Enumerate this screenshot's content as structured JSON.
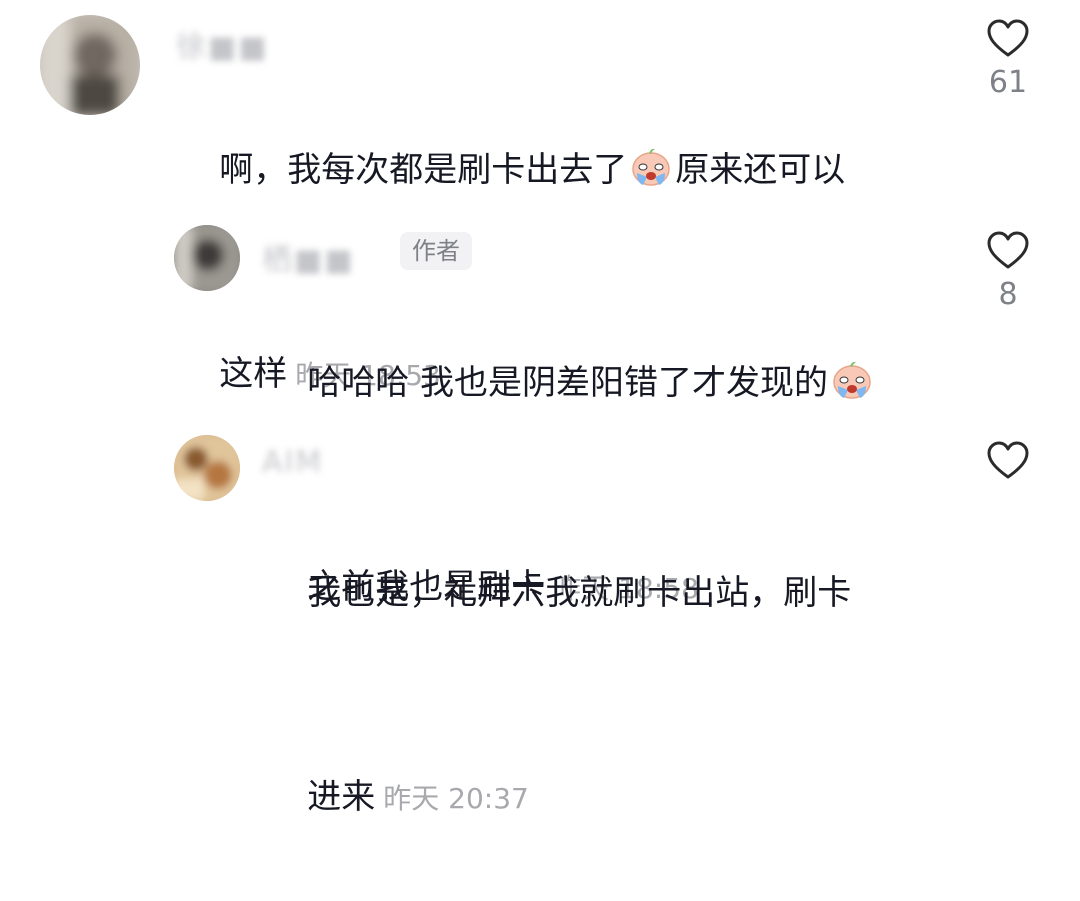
{
  "comments": [
    {
      "username": "徐■■",
      "line1": "啊，我每次都是刷卡出去了",
      "line1_after": "原来还可以",
      "line2": "这样",
      "time": "昨天 18:53",
      "likes": "61",
      "emoji": "crying-baby-emoji",
      "avatar_icon": "blurred-avatar-icon",
      "heart_icon": "heart-outline-icon"
    },
    {
      "username": "栖■■",
      "author_badge": "作者",
      "line1": "哈哈哈 我也是阴差阳错了才发现的",
      "line2": "之前我也是刷卡",
      "time": "昨天 18:58",
      "likes": "8",
      "emoji": "crying-baby-emoji",
      "avatar_icon": "blurred-avatar-icon",
      "heart_icon": "heart-outline-icon"
    },
    {
      "username": "AIM",
      "line1": "我也是，礼拜六我就刷卡出站，刷卡",
      "line2": "进来",
      "time": "昨天 20:37",
      "likes": "",
      "avatar_icon": "blurred-avatar-icon",
      "heart_icon": "heart-outline-icon"
    }
  ],
  "colors": {
    "text": "#161823",
    "muted": "#a8a9ad",
    "badge_bg": "#f2f2f4",
    "icon": "#2b2b2b"
  }
}
